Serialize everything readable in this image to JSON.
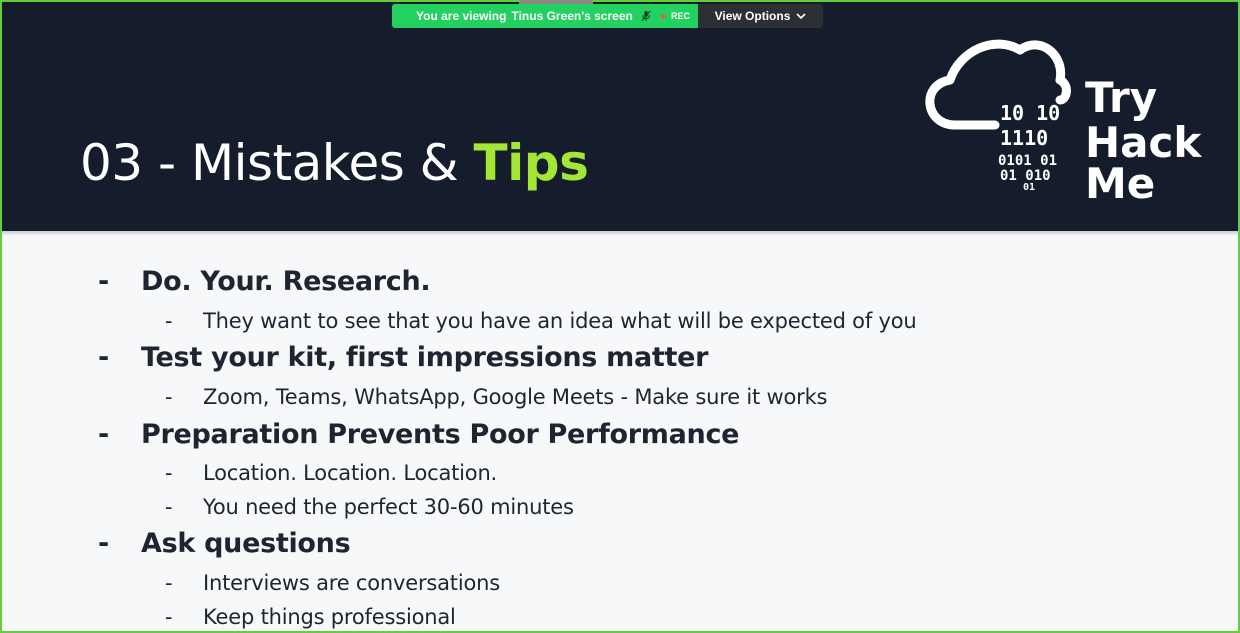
{
  "share_banner": {
    "viewing_prefix": "You are viewing",
    "presenter": "Tinus Green's screen",
    "rec_label": "REC",
    "view_options_label": "View Options"
  },
  "slide": {
    "title_main": "03 - Mistakes & ",
    "title_accent": "Tips",
    "logo": {
      "binary_lines": [
        "10  10",
        "1110",
        "0101  01",
        "01  010",
        "01"
      ],
      "wordmark": [
        "Try",
        "Hack",
        "Me"
      ]
    },
    "bullets": [
      {
        "text": "Do. Your. Research.",
        "subs": [
          "They want to see that you have an idea what will be expected of you"
        ]
      },
      {
        "text": "Test your kit, first impressions matter",
        "subs": [
          "Zoom, Teams, WhatsApp, Google Meets - Make sure it works"
        ]
      },
      {
        "text": "Preparation Prevents Poor Performance",
        "subs": [
          "Location. Location. Location.",
          "You need the perfect 30-60 minutes"
        ]
      },
      {
        "text": "Ask questions",
        "subs": [
          "Interviews are conversations",
          "Keep things professional"
        ]
      }
    ],
    "dash": "-"
  },
  "colors": {
    "header_bg": "#151c2b",
    "accent": "#a3e635",
    "share_green": "#23d160",
    "frame_green": "#5fd03c"
  }
}
